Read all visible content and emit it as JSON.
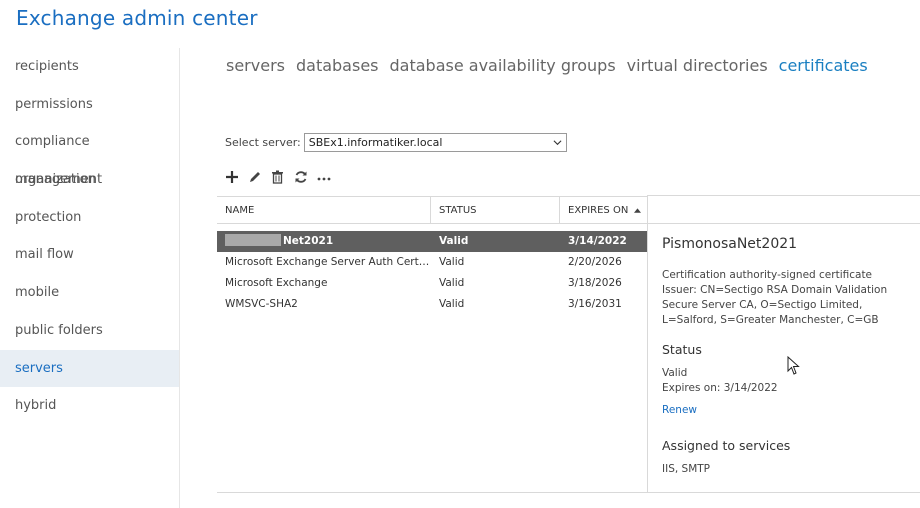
{
  "app": {
    "title": "Exchange admin center"
  },
  "sidebar": {
    "items": [
      {
        "label": "recipients"
      },
      {
        "label": "permissions"
      },
      {
        "label": "compliance management"
      },
      {
        "label": "organization"
      },
      {
        "label": "protection"
      },
      {
        "label": "mail flow"
      },
      {
        "label": "mobile"
      },
      {
        "label": "public folders"
      },
      {
        "label": "servers",
        "active": true
      },
      {
        "label": "hybrid"
      }
    ]
  },
  "tabs": [
    {
      "label": "servers"
    },
    {
      "label": "databases"
    },
    {
      "label": "database availability groups"
    },
    {
      "label": "virtual directories"
    },
    {
      "label": "certificates",
      "active": true
    }
  ],
  "server_select": {
    "label": "Select server:",
    "value": "SBEx1.informatiker.local"
  },
  "toolbar": {
    "icons": [
      "add-icon",
      "edit-icon",
      "delete-icon",
      "refresh-icon",
      "more-icon"
    ]
  },
  "grid": {
    "headers": {
      "name": "NAME",
      "status": "STATUS",
      "expires": "EXPIRES ON"
    },
    "rows": [
      {
        "name": "Net2021",
        "status": "Valid",
        "expires": "3/14/2022",
        "selected": true
      },
      {
        "name": "Microsoft Exchange Server Auth Certifi...",
        "status": "Valid",
        "expires": "2/20/2026"
      },
      {
        "name": "Microsoft Exchange",
        "status": "Valid",
        "expires": "3/18/2026"
      },
      {
        "name": "WMSVC-SHA2",
        "status": "Valid",
        "expires": "3/16/2031"
      }
    ]
  },
  "details": {
    "title": "PismonosaNet2021",
    "type": "Certification authority-signed certificate",
    "issuer": "Issuer: CN=Sectigo RSA Domain Validation Secure Server CA, O=Sectigo Limited, L=Salford, S=Greater Manchester, C=GB",
    "status_heading": "Status",
    "status_value": "Valid",
    "expires": "Expires on: 3/14/2022",
    "renew_label": "Renew",
    "services_heading": "Assigned to services",
    "services_value": "IIS, SMTP"
  },
  "colors": {
    "accent": "#1a6ec1",
    "selected_row": "#5f5f5f",
    "nav_active_bg": "#e8eef4"
  }
}
